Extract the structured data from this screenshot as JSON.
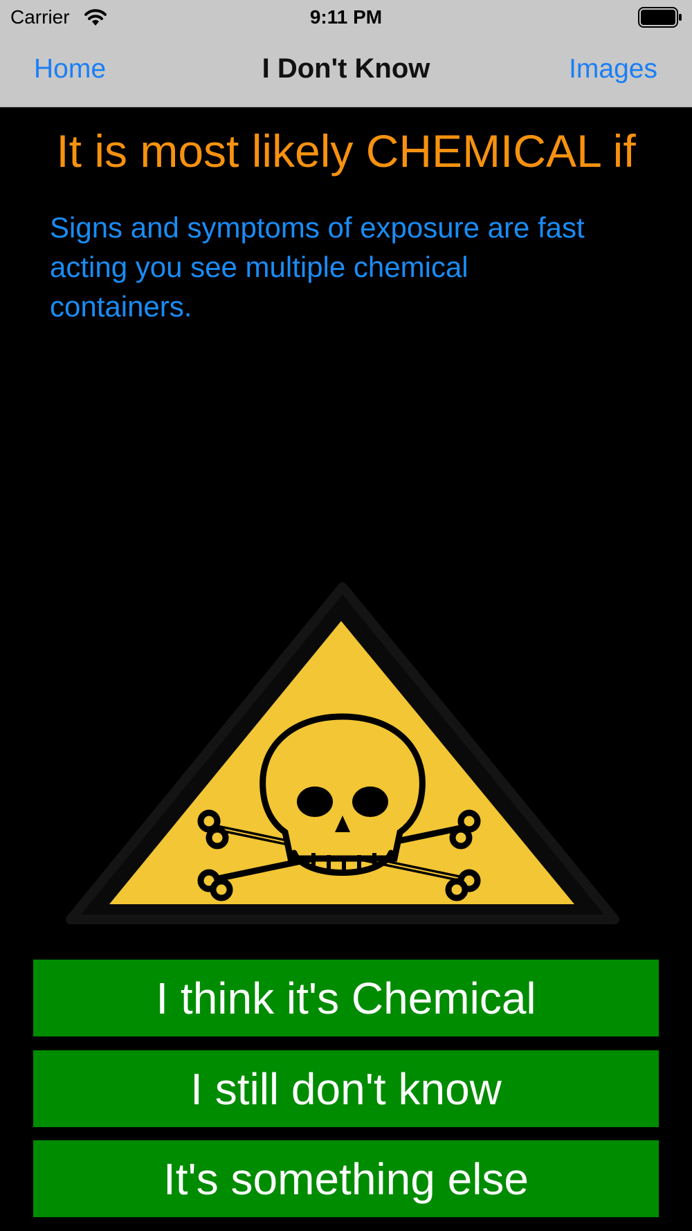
{
  "status_bar": {
    "carrier": "Carrier",
    "time": "9:11 PM"
  },
  "nav": {
    "back_label": "Home",
    "title": "I Don't Know",
    "right_label": "Images"
  },
  "main": {
    "headline": "It is most likely CHEMICAL if",
    "description": "Signs and symptoms of exposure are fast acting you see multiple chemical containers.",
    "hazard_icon": "skull-crossbones-warning-triangle"
  },
  "buttons": [
    {
      "label": "I think it's Chemical"
    },
    {
      "label": "I still don't know"
    },
    {
      "label": "It's something else"
    }
  ],
  "colors": {
    "nav_background": "#c8c8c8",
    "nav_link": "#1a7ff5",
    "headline": "#f6920f",
    "description": "#1a8cf5",
    "button_background": "#008c00",
    "hazard_yellow": "#f2c634"
  }
}
